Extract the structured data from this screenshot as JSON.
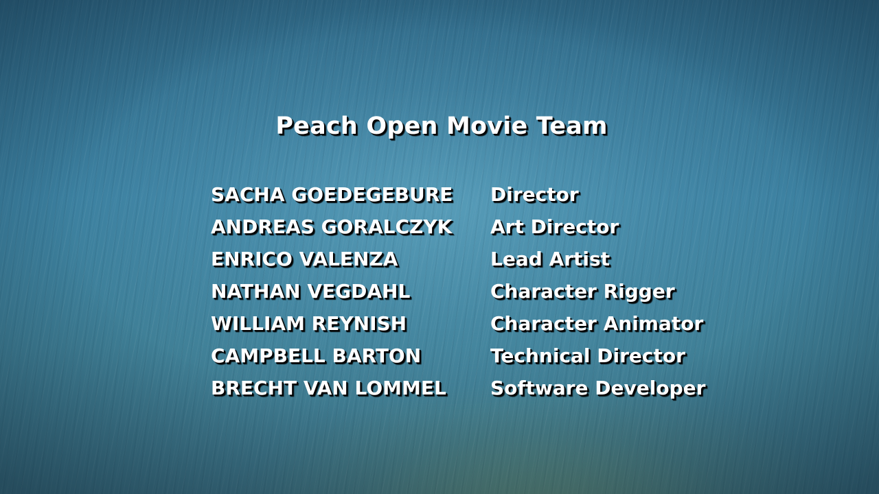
{
  "credits": {
    "title": "Peach Open Movie Team",
    "members": [
      {
        "name": "SACHA GOEDEGEBURE",
        "role": "Director"
      },
      {
        "name": "ANDREAS GORALCZYK",
        "role": "Art Director"
      },
      {
        "name": "ENRICO VALENZA",
        "role": "Lead Artist"
      },
      {
        "name": "NATHAN VEGDAHL",
        "role": "Character Rigger"
      },
      {
        "name": "WILLIAM REYNISH",
        "role": "Character Animator"
      },
      {
        "name": "CAMPBELL BARTON",
        "role": "Technical Director"
      },
      {
        "name": "BRECHT VAN LOMMEL",
        "role": "Software Developer"
      }
    ]
  }
}
